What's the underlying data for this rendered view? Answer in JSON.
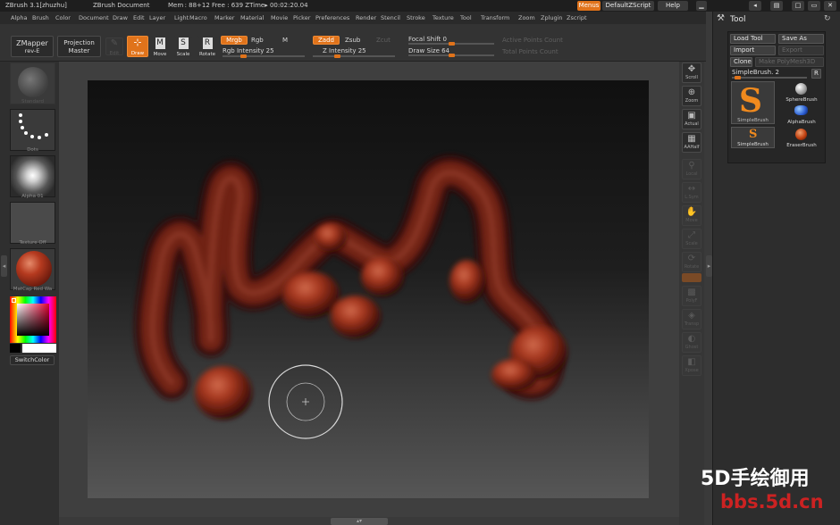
{
  "titlebar": {
    "app": "ZBrush  3.1[zhuzhu]",
    "document": "ZBrush Document",
    "mem": "Mem : 88+12  Free : 639  ZTime▸ 00:02:20.04",
    "menus_btn": "Menus",
    "script_btn": "DefaultZScript",
    "help_btn": "Help"
  },
  "menubar": {
    "items": [
      "Alpha",
      "Brush",
      "Color",
      "Document",
      "Draw",
      "Edit",
      "Layer",
      "Light",
      "Macro",
      "Marker",
      "Material",
      "Movie",
      "Picker",
      "Preferences",
      "Render",
      "Stencil",
      "Stroke",
      "Texture",
      "Tool",
      "Transform",
      "Zoom",
      "Zplugin",
      "Zscript"
    ]
  },
  "shelf": {
    "zmapper": "ZMapper",
    "zmapper_sub": "rev-E",
    "projection": "Projection",
    "projection_sub": "Master",
    "edit": "Edit",
    "draw": "Draw",
    "move": "Move",
    "scale": "Scale",
    "rotate": "Rotate",
    "mrgb": "Mrgb",
    "rgb": "Rgb",
    "m": "M",
    "rgb_intensity": "Rgb  Intensity 25",
    "zadd": "Zadd",
    "zsub": "Zsub",
    "zcut": "Zcut",
    "z_intensity": "Z  Intensity 25",
    "focal_shift": "Focal Shift 0",
    "draw_size": "Draw Size 64",
    "active_points": "Active Points Count",
    "total_points": "Total Points Count"
  },
  "left": {
    "standard": "Standard",
    "dots": "Dots",
    "alpha": "Alpha 01",
    "texture": "Texture Off",
    "matcap": "MatCap Red Wa",
    "switch": "SwitchColor"
  },
  "rightcol": {
    "scroll": "Scroll",
    "zoom": "Zoom",
    "actual": "Actual",
    "aahalf": "AAHalf",
    "local": "Local",
    "lsym": "L.Sym",
    "move": "Move",
    "scale": "Scale",
    "rotate": "Rotate",
    "polyf": "PolyF",
    "transp": "Transp",
    "ghost": "Ghost",
    "xpose": "Xpose"
  },
  "tool": {
    "title": "Tool",
    "load": "Load Tool",
    "save": "Save As",
    "import": "Import",
    "export": "Export",
    "clone": "Clone",
    "make_polymesh": "Make PolyMesh3D",
    "current": "SimpleBrush. 2",
    "r": "R",
    "items": [
      "SimpleBrush",
      "SphereBrush",
      "AlphaBrush",
      "SimpleBrush",
      "EraserBrush"
    ]
  },
  "watermark": {
    "line1": "5D手绘御用",
    "line2": "bbs.5d.cn"
  },
  "colors": {
    "accent": "#e0731b",
    "clay": "#8e2c1a",
    "watermark_red": "#cc2222"
  }
}
